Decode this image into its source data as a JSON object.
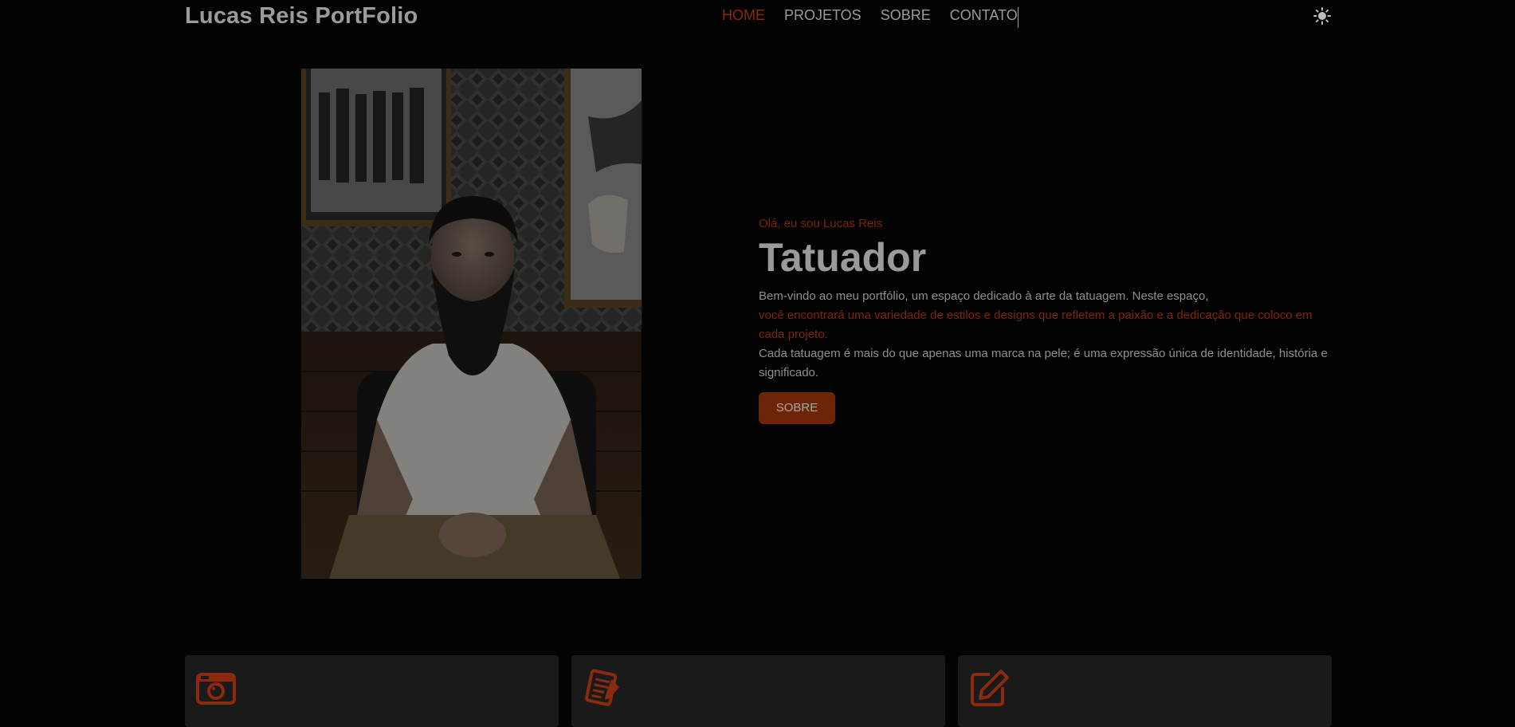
{
  "brand": "Lucas Reis PortFolio",
  "nav": {
    "items": [
      {
        "label": "HOME",
        "active": true
      },
      {
        "label": "PROJETOS",
        "active": false
      },
      {
        "label": "SOBRE",
        "active": false
      },
      {
        "label": "CONTATO",
        "active": false
      }
    ],
    "theme_icon": "sun-icon"
  },
  "hero": {
    "greeting": "Olá, eu sou Lucas Reis",
    "title": "Tatuador",
    "line1": "Bem-vindo ao meu portfólio, um espaço dedicado à arte da tatuagem. Neste espaço,",
    "line2": "você encontrará uma variedade de estilos e designs que refletem a paixão e a dedicação que coloco em cada projeto.",
    "line3": "Cada tatuagem é mais do que apenas uma marca na pele; é uma expressão única de identidade, história e significado.",
    "button": "SOBRE",
    "image": "portrait-photo"
  },
  "cards": [
    {
      "icon": "camera-icon"
    },
    {
      "icon": "notes-icon"
    },
    {
      "icon": "edit-icon"
    }
  ],
  "colors": {
    "background": "#030303",
    "accent": "#8a2a0e",
    "card": "#1a1a1a"
  }
}
